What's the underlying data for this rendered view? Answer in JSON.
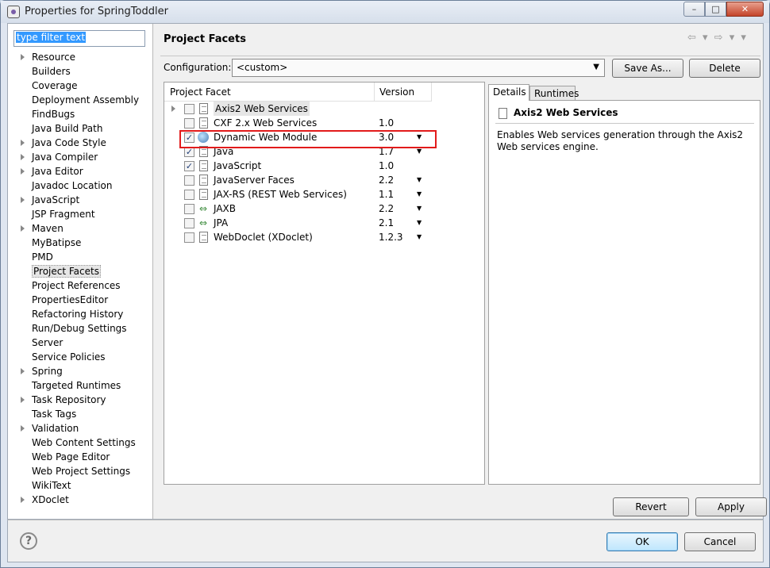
{
  "window": {
    "title": "Properties for SpringToddler",
    "min_symbol": "–",
    "max_symbol": "□",
    "close_symbol": "✕"
  },
  "filter": {
    "value": "type filter text"
  },
  "nav": {
    "items": [
      {
        "label": "Resource",
        "expandable": true
      },
      {
        "label": "Builders",
        "expandable": false
      },
      {
        "label": "Coverage",
        "expandable": false
      },
      {
        "label": "Deployment Assembly",
        "expandable": false
      },
      {
        "label": "FindBugs",
        "expandable": false
      },
      {
        "label": "Java Build Path",
        "expandable": false
      },
      {
        "label": "Java Code Style",
        "expandable": true
      },
      {
        "label": "Java Compiler",
        "expandable": true
      },
      {
        "label": "Java Editor",
        "expandable": true
      },
      {
        "label": "Javadoc Location",
        "expandable": false
      },
      {
        "label": "JavaScript",
        "expandable": true
      },
      {
        "label": "JSP Fragment",
        "expandable": false
      },
      {
        "label": "Maven",
        "expandable": true
      },
      {
        "label": "MyBatipse",
        "expandable": false
      },
      {
        "label": "PMD",
        "expandable": false
      },
      {
        "label": "Project Facets",
        "expandable": false,
        "selected": true
      },
      {
        "label": "Project References",
        "expandable": false
      },
      {
        "label": "PropertiesEditor",
        "expandable": false
      },
      {
        "label": "Refactoring History",
        "expandable": false
      },
      {
        "label": "Run/Debug Settings",
        "expandable": false
      },
      {
        "label": "Server",
        "expandable": false
      },
      {
        "label": "Service Policies",
        "expandable": false
      },
      {
        "label": "Spring",
        "expandable": true
      },
      {
        "label": "Targeted Runtimes",
        "expandable": false
      },
      {
        "label": "Task Repository",
        "expandable": true
      },
      {
        "label": "Task Tags",
        "expandable": false
      },
      {
        "label": "Validation",
        "expandable": true
      },
      {
        "label": "Web Content Settings",
        "expandable": false
      },
      {
        "label": "Web Page Editor",
        "expandable": false
      },
      {
        "label": "Web Project Settings",
        "expandable": false
      },
      {
        "label": "WikiText",
        "expandable": false
      },
      {
        "label": "XDoclet",
        "expandable": true
      }
    ]
  },
  "page": {
    "title": "Project Facets",
    "configuration_label": "Configuration:",
    "configuration_value": "<custom>",
    "save_as_label": "Save As...",
    "delete_label": "Delete",
    "nav_arrows": "⇦ ▾ ⇨ ▾ ▾"
  },
  "facets": {
    "headers": {
      "name": "Project Facet",
      "version": "Version"
    },
    "rows": [
      {
        "name": "Axis2 Web Services",
        "version": "",
        "checked": false,
        "expandable": true,
        "icon": "doc",
        "dropdown": false,
        "selected": true
      },
      {
        "name": "CXF 2.x Web Services",
        "version": "1.0",
        "checked": false,
        "expandable": false,
        "icon": "doc",
        "dropdown": false
      },
      {
        "name": "Dynamic Web Module",
        "version": "3.0",
        "checked": true,
        "expandable": false,
        "icon": "web",
        "dropdown": true
      },
      {
        "name": "Java",
        "version": "1.7",
        "checked": true,
        "expandable": false,
        "icon": "doc",
        "dropdown": true
      },
      {
        "name": "JavaScript",
        "version": "1.0",
        "checked": true,
        "expandable": false,
        "icon": "doc",
        "dropdown": false
      },
      {
        "name": "JavaServer Faces",
        "version": "2.2",
        "checked": false,
        "expandable": false,
        "icon": "doc",
        "dropdown": true
      },
      {
        "name": "JAX-RS (REST Web Services)",
        "version": "1.1",
        "checked": false,
        "expandable": false,
        "icon": "doc",
        "dropdown": true
      },
      {
        "name": "JAXB",
        "version": "2.2",
        "checked": false,
        "expandable": false,
        "icon": "swap",
        "dropdown": true
      },
      {
        "name": "JPA",
        "version": "2.1",
        "checked": false,
        "expandable": false,
        "icon": "swap",
        "dropdown": true
      },
      {
        "name": "WebDoclet (XDoclet)",
        "version": "1.2.3",
        "checked": false,
        "expandable": false,
        "icon": "doc",
        "dropdown": true
      }
    ]
  },
  "details": {
    "tabs": [
      "Details",
      "Runtimes"
    ],
    "title": "Axis2 Web Services",
    "description": "Enables Web services generation through the Axis2 Web services engine."
  },
  "buttons": {
    "revert": "Revert",
    "apply": "Apply",
    "ok": "OK",
    "cancel": "Cancel",
    "help": "?"
  },
  "colors": {
    "highlight_box": "#e21b1b",
    "filter_selection": "#3399ff",
    "ok_button_border": "#3c7fb1"
  }
}
